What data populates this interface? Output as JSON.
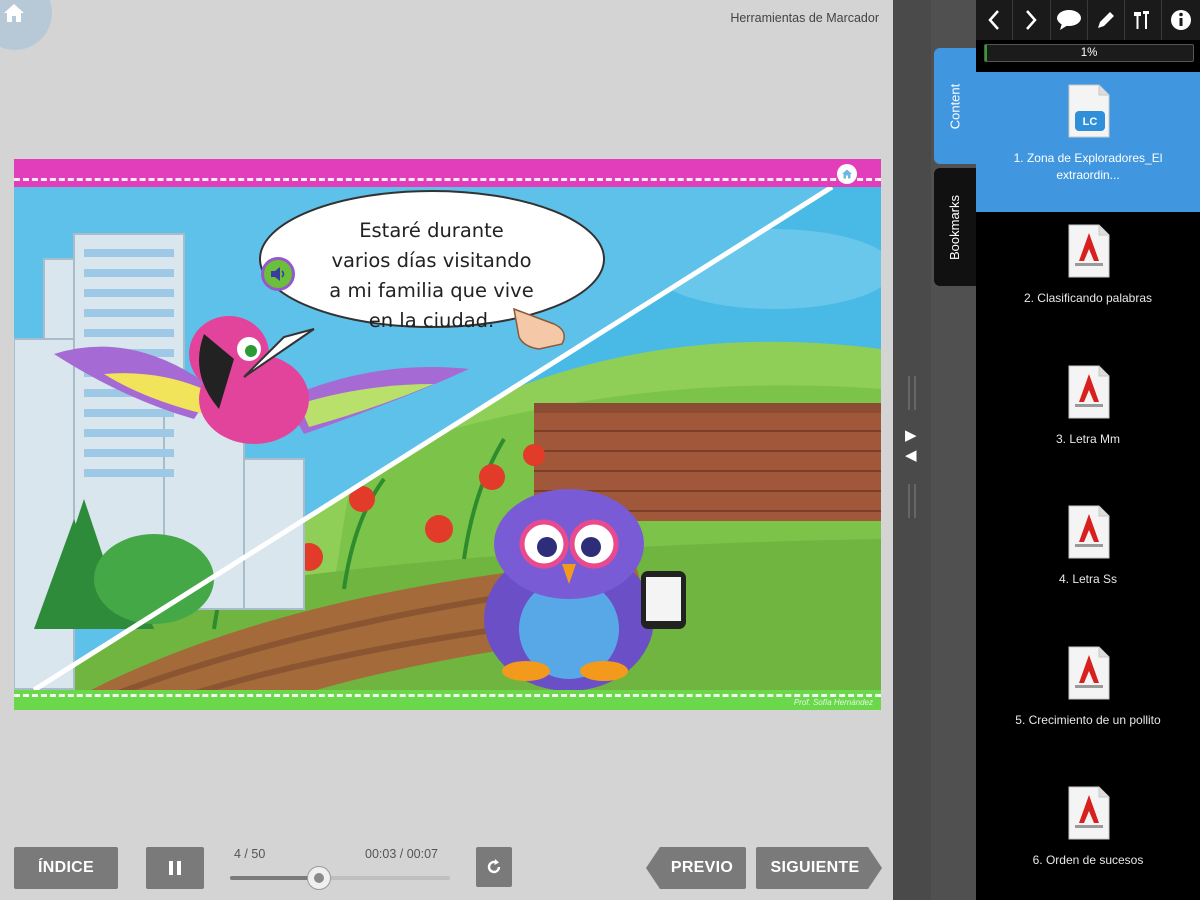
{
  "header": {
    "marker_tools": "Herramientas de Marcador"
  },
  "slide": {
    "speech_text": "Estaré durante\nvarios días visitando\na mi familia que vive\nen la ciudad.",
    "credit": "Prof. Sofía Hernández"
  },
  "controls": {
    "index_label": "ÍNDICE",
    "slide_count": "4 / 50",
    "time": "00:03 / 00:07",
    "progress": 0.4,
    "prev_label": "PREVIO",
    "next_label": "SIGUIENTE"
  },
  "sidebar": {
    "tabs": [
      {
        "label": "Content"
      },
      {
        "label": "Bookmarks"
      }
    ],
    "progress_text": "1%",
    "progress_value": 0.01,
    "toolbar_icons": [
      "chevron-left-icon",
      "chevron-right-icon",
      "comment-icon",
      "pencil-icon",
      "tools-icon",
      "info-icon"
    ],
    "items": [
      {
        "label": "1. Zona de Exploradores_El extraordin...",
        "badge": "LC",
        "selected": true
      },
      {
        "label": "2. Clasificando palabras"
      },
      {
        "label": "3. Letra Mm"
      },
      {
        "label": "4. Letra Ss"
      },
      {
        "label": "5. Crecimiento de un pollito"
      },
      {
        "label": "6. Orden de sucesos"
      }
    ]
  },
  "colors": {
    "accent": "#4097e0",
    "slide_top": "#e23dba",
    "slide_bottom": "#6bd84c",
    "button": "#7a7a7a"
  }
}
